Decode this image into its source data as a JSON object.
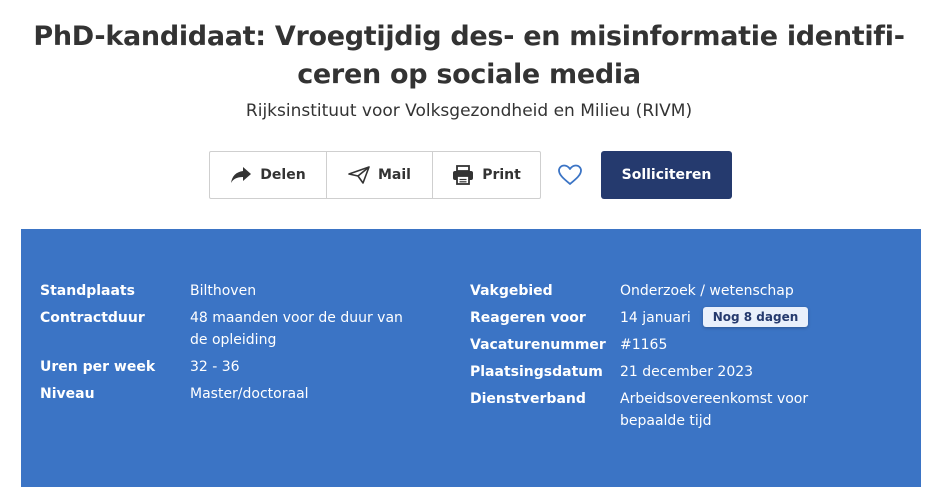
{
  "job": {
    "title": "PhD-kandidaat: Vroegtijdig des- en misinformatie identifi-ceren op sociale media",
    "organization": "Rijksinstituut voor Volksgezondheid en Milieu (RIVM)"
  },
  "actions": {
    "share": "Delen",
    "mail": "Mail",
    "print": "Print",
    "apply": "Solliciteren"
  },
  "details_left": [
    {
      "label": "Standplaats",
      "value": "Bilthoven"
    },
    {
      "label": "Contractduur",
      "value": "48 maanden voor de duur van de opleiding"
    },
    {
      "label": "Uren per week",
      "value": "32 - 36"
    },
    {
      "label": "Niveau",
      "value": "Master/doctoraal"
    }
  ],
  "details_right": [
    {
      "label": "Vakgebied",
      "value": "Onderzoek / wetenschap"
    },
    {
      "label": "Reageren voor",
      "value": "14 januari",
      "badge": "Nog 8 dagen"
    },
    {
      "label": "Vacaturenummer",
      "value": "#1165"
    },
    {
      "label": "Plaatsingsdatum",
      "value": "21 december 2023"
    },
    {
      "label": "Dienstverband",
      "value": "Arbeidsovereenkomst voor bepaalde tijd"
    }
  ],
  "colors": {
    "panel": "#3b74c5",
    "apply_button": "#253a6e",
    "heart_icon": "#3b74c5"
  },
  "icons": {
    "share": "share-arrow-icon",
    "mail": "paper-plane-icon",
    "print": "printer-icon",
    "favorite": "heart-outline-icon"
  }
}
